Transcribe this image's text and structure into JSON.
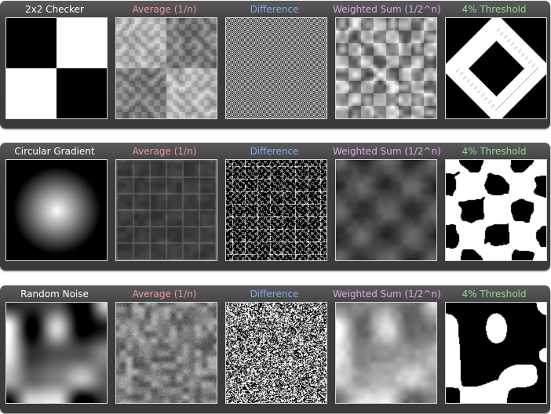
{
  "colors": {
    "source": "#ffffff",
    "average": "#f19a9a",
    "difference": "#7fb0f0",
    "weighted": "#e2a6ee",
    "threshold": "#8fdc8f"
  },
  "column_titles": {
    "average": "Average (1/n)",
    "difference": "Difference",
    "weighted": "Weighted Sum (1/2^n)",
    "threshold": "4% Threshold"
  },
  "rows": [
    {
      "source_title": "2x2 Checker"
    },
    {
      "source_title": "Circular Gradient"
    },
    {
      "source_title": "Random Noise"
    }
  ]
}
